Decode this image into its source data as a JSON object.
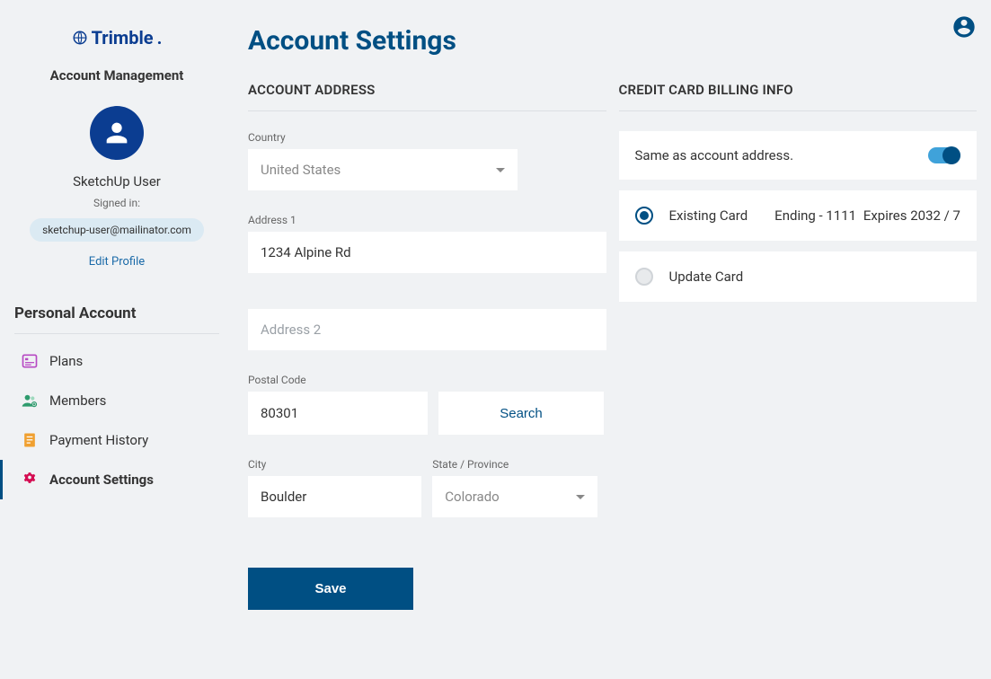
{
  "brand": "Trimble",
  "sidebar": {
    "account_mgmt": "Account Management",
    "user_name": "SketchUp User",
    "signed_in": "Signed in:",
    "email": "sketchup-user@mailinator.com",
    "edit_profile": "Edit Profile",
    "section": "Personal Account",
    "nav": {
      "plans": "Plans",
      "members": "Members",
      "payment_history": "Payment History",
      "account_settings": "Account Settings"
    }
  },
  "page": {
    "title": "Account Settings"
  },
  "address": {
    "header": "ACCOUNT ADDRESS",
    "country_label": "Country",
    "country_value": "United States",
    "address1_label": "Address 1",
    "address1_value": "1234 Alpine Rd",
    "address2_placeholder": "Address 2",
    "postal_label": "Postal Code",
    "postal_value": "80301",
    "search": "Search",
    "city_label": "City",
    "city_value": "Boulder",
    "state_label": "State / Province",
    "state_value": "Colorado",
    "save": "Save"
  },
  "billing": {
    "header": "CREDIT CARD BILLING INFO",
    "same_as": "Same as account address.",
    "existing_card": "Existing Card",
    "ending": "Ending - 1111",
    "expires": "Expires 2032 / 7",
    "update_card": "Update Card"
  }
}
